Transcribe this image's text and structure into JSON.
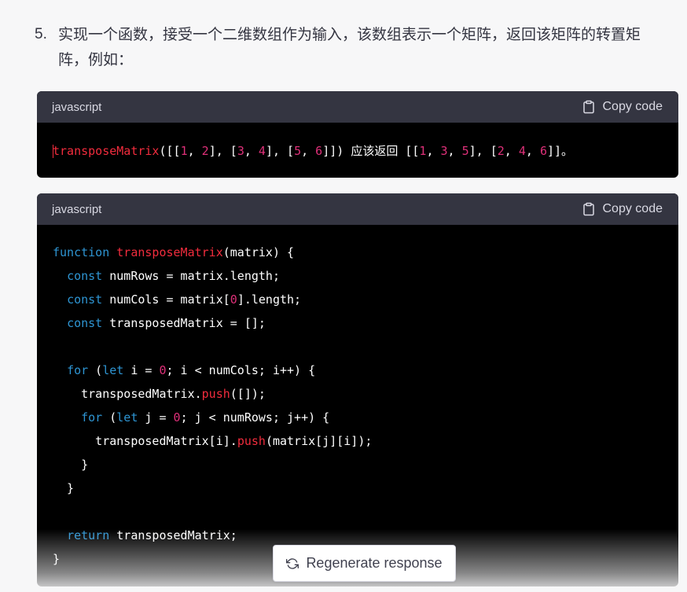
{
  "list_item": {
    "number": "5.",
    "text_line1": "实现一个函数，接受一个二维数组作为输入，该数组表示一个矩阵，返回该矩阵的转置矩",
    "text_line2": "阵，例如："
  },
  "code_blocks": [
    {
      "language": "javascript",
      "copy_label": "Copy code",
      "lines": [
        [
          {
            "t": "transposeMatrix",
            "c": "fn"
          },
          {
            "t": "([["
          },
          {
            "t": "1",
            "c": "num"
          },
          {
            "t": ", "
          },
          {
            "t": "2",
            "c": "num"
          },
          {
            "t": "], ["
          },
          {
            "t": "3",
            "c": "num"
          },
          {
            "t": ", "
          },
          {
            "t": "4",
            "c": "num"
          },
          {
            "t": "], ["
          },
          {
            "t": "5",
            "c": "num"
          },
          {
            "t": ", "
          },
          {
            "t": "6",
            "c": "num"
          },
          {
            "t": "]]) "
          },
          {
            "t": "应该返回",
            "c": "cjk"
          },
          {
            "t": " [["
          },
          {
            "t": "1",
            "c": "num"
          },
          {
            "t": ", "
          },
          {
            "t": "3",
            "c": "num"
          },
          {
            "t": ", "
          },
          {
            "t": "5",
            "c": "num"
          },
          {
            "t": "], ["
          },
          {
            "t": "2",
            "c": "num"
          },
          {
            "t": ", "
          },
          {
            "t": "4",
            "c": "num"
          },
          {
            "t": ", "
          },
          {
            "t": "6",
            "c": "num"
          },
          {
            "t": "]]"
          },
          {
            "t": "。",
            "c": "cjk"
          }
        ]
      ]
    },
    {
      "language": "javascript",
      "copy_label": "Copy code",
      "lines": [
        [
          {
            "t": "function",
            "c": "kw"
          },
          {
            "t": " "
          },
          {
            "t": "transposeMatrix",
            "c": "fn"
          },
          {
            "t": "(matrix) {"
          }
        ],
        [
          {
            "t": "  "
          },
          {
            "t": "const",
            "c": "kw"
          },
          {
            "t": " numRows = matrix."
          },
          {
            "t": "length"
          },
          {
            "t": ";"
          }
        ],
        [
          {
            "t": "  "
          },
          {
            "t": "const",
            "c": "kw"
          },
          {
            "t": " numCols = matrix["
          },
          {
            "t": "0",
            "c": "num"
          },
          {
            "t": "].length;"
          }
        ],
        [
          {
            "t": "  "
          },
          {
            "t": "const",
            "c": "kw"
          },
          {
            "t": " transposedMatrix = [];"
          }
        ],
        [
          {
            "t": ""
          }
        ],
        [
          {
            "t": "  "
          },
          {
            "t": "for",
            "c": "kw"
          },
          {
            "t": " ("
          },
          {
            "t": "let",
            "c": "kw"
          },
          {
            "t": " i = "
          },
          {
            "t": "0",
            "c": "num"
          },
          {
            "t": "; i < numCols; i++) {"
          }
        ],
        [
          {
            "t": "    transposedMatrix."
          },
          {
            "t": "push",
            "c": "fn"
          },
          {
            "t": "([]);"
          }
        ],
        [
          {
            "t": "    "
          },
          {
            "t": "for",
            "c": "kw"
          },
          {
            "t": " ("
          },
          {
            "t": "let",
            "c": "kw"
          },
          {
            "t": " j = "
          },
          {
            "t": "0",
            "c": "num"
          },
          {
            "t": "; j < numRows; j++) {"
          }
        ],
        [
          {
            "t": "      transposedMatrix[i]."
          },
          {
            "t": "push",
            "c": "fn"
          },
          {
            "t": "(matrix[j][i]);"
          }
        ],
        [
          {
            "t": "    }"
          }
        ],
        [
          {
            "t": "  }"
          }
        ],
        [
          {
            "t": ""
          }
        ],
        [
          {
            "t": "  "
          },
          {
            "t": "return",
            "c": "kw"
          },
          {
            "t": " transposedMatrix;"
          }
        ],
        [
          {
            "t": "}"
          }
        ]
      ]
    }
  ],
  "regenerate_label": "Regenerate response",
  "icons": {
    "copy": "clipboard-icon",
    "regenerate": "refresh-icon"
  },
  "colors": {
    "keyword": "#2e95d3",
    "function": "#f22c3d",
    "number": "#df3079",
    "code_bg": "#000000",
    "header_bg": "#343541"
  }
}
